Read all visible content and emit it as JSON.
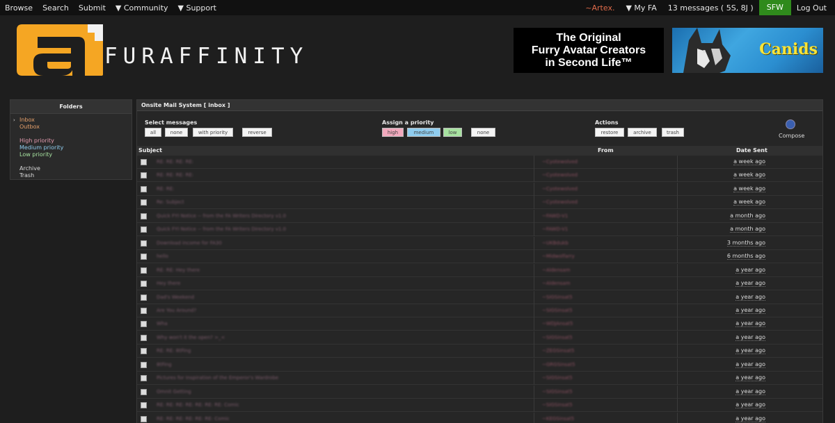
{
  "nav": {
    "left": [
      "Browse",
      "Search",
      "Submit",
      "▼ Community",
      "▼ Support"
    ],
    "user": "~Artex.",
    "myfa": "▼ My FA",
    "messages": "13 messages ( 5S, 8J )",
    "sfw": "SFW",
    "logout": "Log Out"
  },
  "header": {
    "logo_text": "FURAFFINITY",
    "ad1_lines": [
      "The Original",
      "Furry Avatar Creators",
      "in Second Life™"
    ],
    "ad2_text": "Canids"
  },
  "sidebar": {
    "title": "Folders",
    "items": [
      "Inbox",
      "Outbox",
      "High priority",
      "Medium priority",
      "Low priority",
      "Archive",
      "Trash"
    ]
  },
  "main": {
    "title": "Onsite Mail System [ inbox ]",
    "select_label": "Select messages",
    "select_buttons": [
      "all",
      "none",
      "with priority",
      "reverse"
    ],
    "priority_label": "Assign a priority",
    "priority_buttons": [
      "high",
      "medium",
      "low",
      "none"
    ],
    "actions_label": "Actions",
    "action_buttons": [
      "restore",
      "archive",
      "trash"
    ],
    "compose": "Compose",
    "columns": [
      "Subject",
      "From",
      "Date Sent"
    ],
    "messages": [
      {
        "subject": "RE: RE: RE: RE:",
        "from": "~Cyotewolved",
        "date": "a week ago"
      },
      {
        "subject": "RE: RE: RE: RE:",
        "from": "~Cyotewolved",
        "date": "a week ago"
      },
      {
        "subject": "RE: RE:",
        "from": "~Cyotewolved",
        "date": "a week ago"
      },
      {
        "subject": "Re: Subject",
        "from": "~Cyotewolved",
        "date": "a week ago"
      },
      {
        "subject": "Quick FYI Notice -- from the FA Writers Directory v1.0",
        "from": "~FAWD-V1",
        "date": "a month ago"
      },
      {
        "subject": "Quick FYI Notice -- from the FA Writers Directory v1.0",
        "from": "~FAWD-V1",
        "date": "a month ago"
      },
      {
        "subject": "Download income for FA30",
        "from": "~UKBdukb",
        "date": "3 months ago"
      },
      {
        "subject": "hello",
        "from": "~Midwolfarry",
        "date": "6 months ago"
      },
      {
        "subject": "RE: RE: Hey there",
        "from": "~Aldensam",
        "date": "a year ago"
      },
      {
        "subject": "Hey there",
        "from": "~Aldensam",
        "date": "a year ago"
      },
      {
        "subject": "Dad's Weekend",
        "from": "~SIGSinsat5",
        "date": "a year ago"
      },
      {
        "subject": "Are You Around?",
        "from": "~SIGSinsat5",
        "date": "a year ago"
      },
      {
        "subject": "Wha",
        "from": "~WDJAnsat5",
        "date": "a year ago"
      },
      {
        "subject": "Why won't it the open? >_<",
        "from": "~SIGSinsat5",
        "date": "a year ago"
      },
      {
        "subject": "RE: RE: 8tFing",
        "from": "~ZEGSinsat5",
        "date": "a year ago"
      },
      {
        "subject": "8tFing",
        "from": "~GRGSinsat5",
        "date": "a year ago"
      },
      {
        "subject": "Pictures for Inspiration of the Emperor's Wardrobe",
        "from": "~SIGSinsat5",
        "date": "a year ago"
      },
      {
        "subject": "Omnit Getting",
        "from": "~SIGSinsat5",
        "date": "a year ago"
      },
      {
        "subject": "RE: RE: RE: RE: RE: RE: RE: Comic",
        "from": "~SIGSinsat5",
        "date": "a year ago"
      },
      {
        "subject": "RE: RE: RE: RE: RE: RE: Comic",
        "from": "~KEGSinsat5",
        "date": "a year ago"
      }
    ]
  },
  "colors": {
    "sfw": "#2f8a1c",
    "logo_orange": "#f5a623",
    "user_link": "#e06b4a",
    "inbox_link": "#e7a16b",
    "high": "#e59cb0",
    "medium": "#8fcdef",
    "low": "#a7e2a0"
  }
}
